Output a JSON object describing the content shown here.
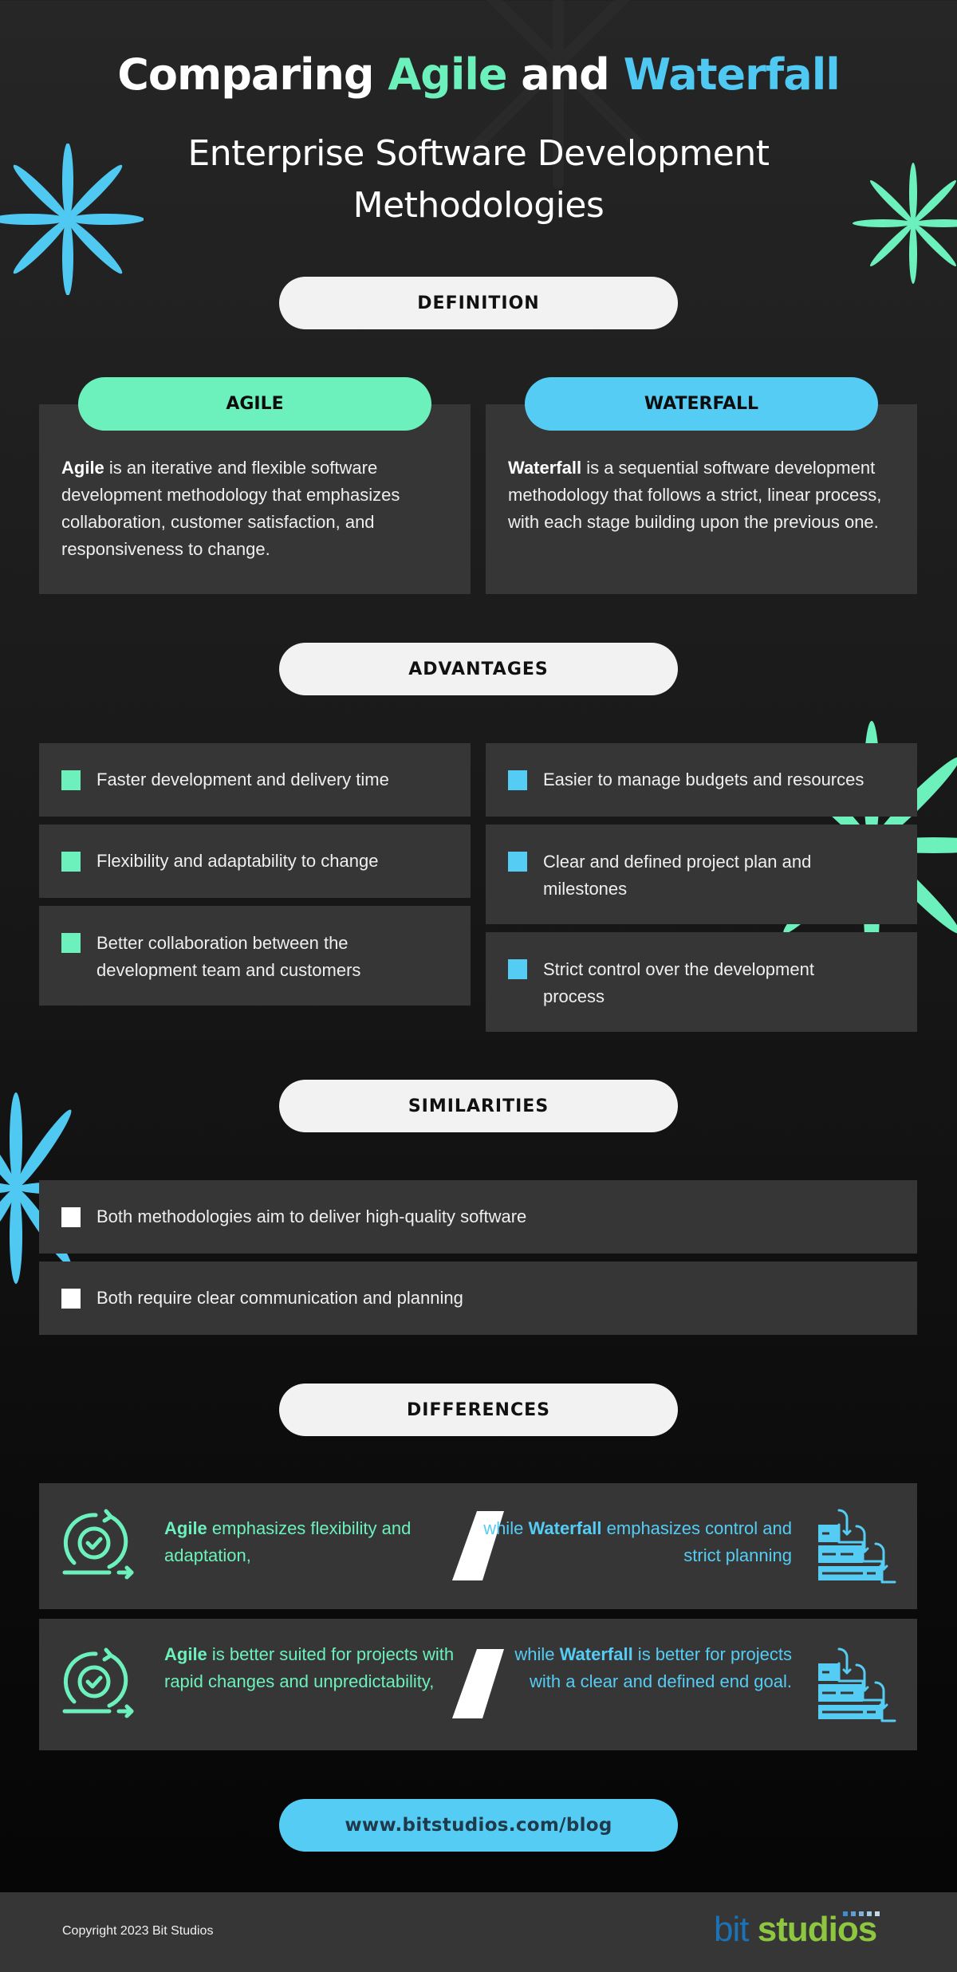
{
  "header": {
    "title_prefix": "Comparing ",
    "title_agile": "Agile",
    "title_mid": " and ",
    "title_waterfall": "Waterfall",
    "subtitle_line1": "Enterprise Software Development",
    "subtitle_line2": "Methodologies"
  },
  "colors": {
    "agile": "#6cf1bd",
    "waterfall": "#55ccf4",
    "card_bg": "#363636",
    "pill_bg": "#f2f2f2",
    "logo_bit": "#1b73b5",
    "logo_studios": "#8dc63f"
  },
  "sections": {
    "definition": "DEFINITION",
    "advantages": "ADVANTAGES",
    "similarities": "SIMILARITIES",
    "differences": "DIFFERENCES"
  },
  "definition": {
    "agile": {
      "label": "AGILE",
      "term": "Agile",
      "text": " is an iterative and flexible software development methodology that emphasizes collaboration, customer satisfaction, and responsiveness to change."
    },
    "waterfall": {
      "label": "WATERFALL",
      "term": "Waterfall",
      "text": " is a sequential software development methodology that follows a strict, linear process, with each stage building upon the previous one."
    }
  },
  "advantages": {
    "agile": [
      "Faster development and delivery time",
      "Flexibility and adaptability to change",
      "Better collaboration between the development team and customers"
    ],
    "waterfall": [
      "Easier to manage budgets and resources",
      "Clear and defined project plan and milestones",
      "Strict control over the development process"
    ]
  },
  "similarities": [
    "Both methodologies aim to deliver high-quality software",
    "Both require clear communication and planning"
  ],
  "differences": [
    {
      "agile_term": "Agile",
      "agile_text": " emphasizes flexibility and adaptation,",
      "waterfall_prefix": "while ",
      "waterfall_term": "Waterfall",
      "waterfall_text": " emphasizes control and strict planning",
      "agile_icon": "agile-cycle-icon",
      "waterfall_icon": "waterfall-steps-icon"
    },
    {
      "agile_term": "Agile",
      "agile_text": " is better suited for projects with rapid changes and unpredictability,",
      "waterfall_prefix": "while ",
      "waterfall_term": "Waterfall",
      "waterfall_text": " is better for projects with a clear and defined end goal.",
      "agile_icon": "agile-cycle-icon",
      "waterfall_icon": "waterfall-steps-icon"
    }
  ],
  "cta": {
    "url": "www.bitstudios.com/blog"
  },
  "footer": {
    "copyright": "Copyright 2023 Bit Studios",
    "logo_bit": "bit",
    "logo_studios": "studios"
  }
}
